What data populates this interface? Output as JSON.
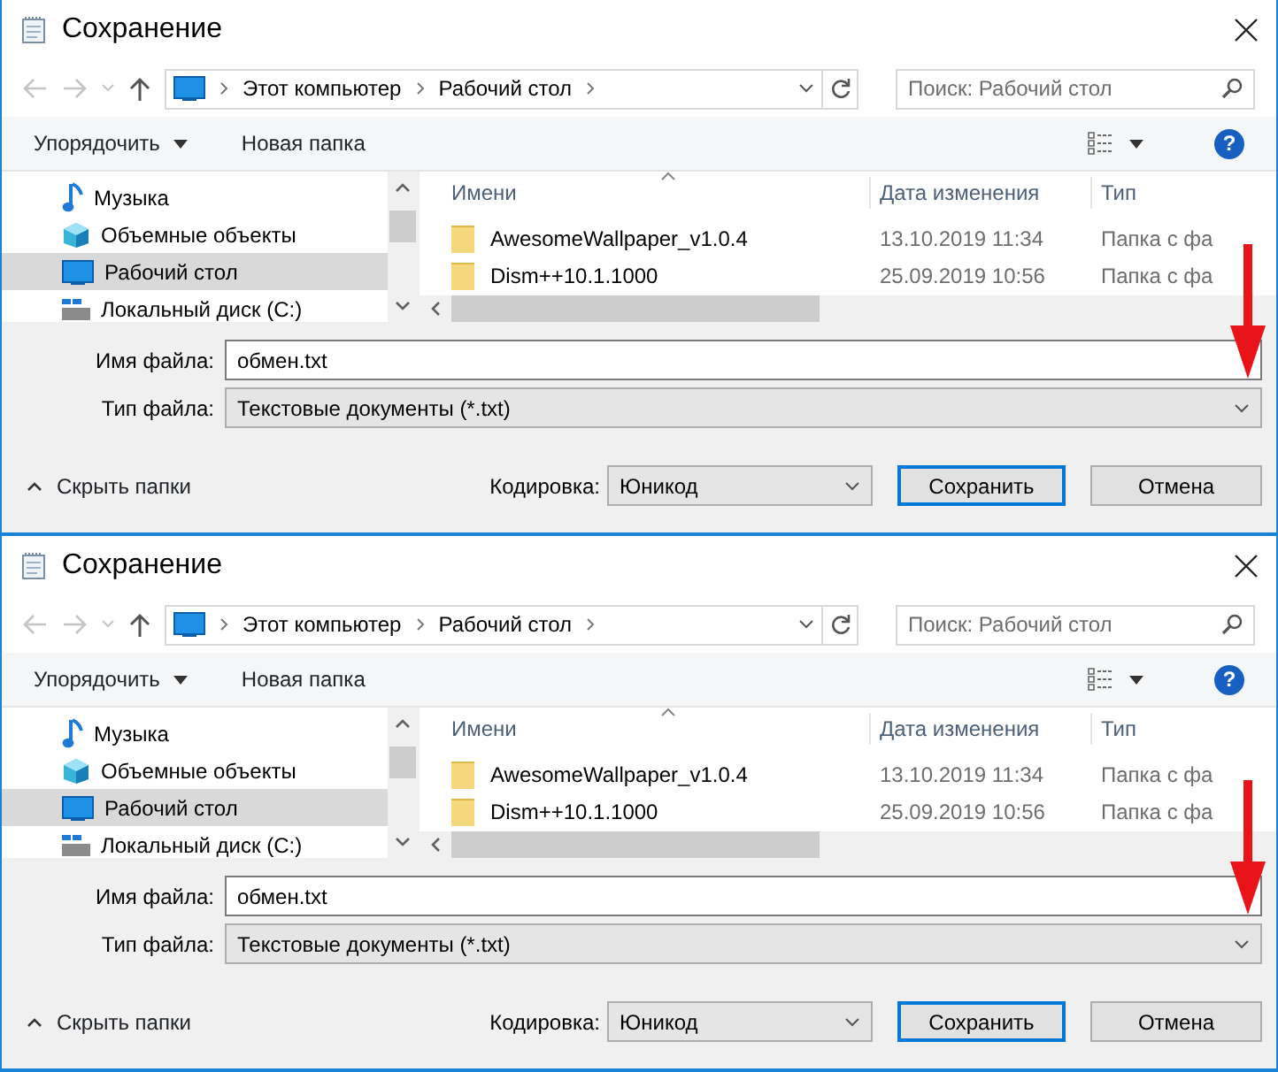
{
  "dialogs": [
    {
      "title": "Сохранение",
      "crumbs": [
        "Этот компьютер",
        "Рабочий стол"
      ],
      "search": {
        "placeholder": "Поиск: Рабочий стол"
      },
      "toolbar": {
        "organize": "Упорядочить",
        "new_folder": "Новая папка",
        "help": "?"
      },
      "sidebar": [
        {
          "label": "Музыка",
          "kind": "music",
          "selected": false
        },
        {
          "label": "Объемные объекты",
          "kind": "objects3d",
          "selected": false
        },
        {
          "label": "Рабочий стол",
          "kind": "desktop",
          "selected": true
        },
        {
          "label": "Локальный диск (C:)",
          "kind": "drive",
          "selected": false
        }
      ],
      "columns": [
        "Имени",
        "Дата изменения",
        "Тип"
      ],
      "rows": [
        {
          "name": "AwesomeWallpaper_v1.0.4",
          "date": "13.10.2019 11:34",
          "type": "Папка с фа"
        },
        {
          "name": "Dism++10.1.1000",
          "date": "25.09.2019 10:56",
          "type": "Папка с фа"
        }
      ],
      "filename": {
        "label": "Имя файла:",
        "value": "обмен.txt"
      },
      "filetype": {
        "label": "Тип файла:",
        "value": "Текстовые документы (*.txt)"
      },
      "hide_folders": "Скрыть папки",
      "encoding": {
        "label": "Кодировка:",
        "value": "Юникод"
      },
      "buttons": [
        {
          "label": "Сохранить",
          "default": true
        },
        {
          "label": "Отмена",
          "default": false
        }
      ]
    },
    {
      "title": "Сохранение",
      "crumbs": [
        "Этот компьютер",
        "Рабочий стол"
      ],
      "search": {
        "placeholder": "Поиск: Рабочий стол"
      },
      "toolbar": {
        "organize": "Упорядочить",
        "new_folder": "Новая папка",
        "help": "?"
      },
      "sidebar": [
        {
          "label": "Музыка",
          "kind": "music",
          "selected": false
        },
        {
          "label": "Объемные объекты",
          "kind": "objects3d",
          "selected": false
        },
        {
          "label": "Рабочий стол",
          "kind": "desktop",
          "selected": true
        },
        {
          "label": "Локальный диск (C:)",
          "kind": "drive",
          "selected": false
        }
      ],
      "columns": [
        "Имени",
        "Дата изменения",
        "Тип"
      ],
      "rows": [
        {
          "name": "AwesomeWallpaper_v1.0.4",
          "date": "13.10.2019 11:34",
          "type": "Папка с фа"
        },
        {
          "name": "Dism++10.1.1000",
          "date": "25.09.2019 10:56",
          "type": "Папка с фа"
        }
      ],
      "filename": {
        "label": "Имя файла:",
        "value": "обмен.txt"
      },
      "filetype": {
        "label": "Тип файла:",
        "value": "Текстовые документы (*.txt)"
      },
      "hide_folders": "Скрыть папки",
      "encoding": {
        "label": "Кодировка:",
        "value": "Юникод"
      },
      "buttons": [
        {
          "label": "Сохранить",
          "default": true
        },
        {
          "label": "Отмена",
          "default": false
        }
      ]
    }
  ]
}
